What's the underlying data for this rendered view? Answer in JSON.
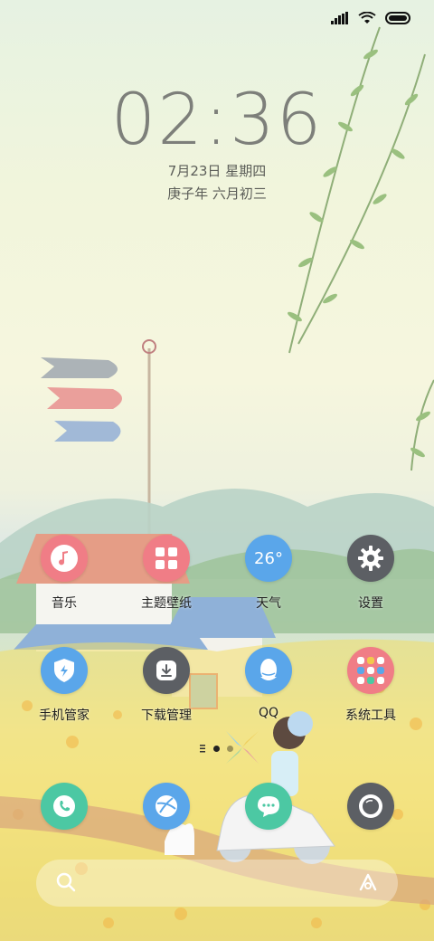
{
  "status": {
    "signal_icon": "cellular-signal-icon",
    "wifi_icon": "wifi-icon",
    "battery_icon": "battery-icon"
  },
  "lockscreen": {
    "time": "02:36",
    "date": "7月23日 星期四",
    "lunar_date": "庚子年 六月初三"
  },
  "apps": [
    {
      "id": "music",
      "label": "音乐",
      "icon": "music-note-icon",
      "color": "#f07d86"
    },
    {
      "id": "themes",
      "label": "主题壁纸",
      "icon": "theme-grid-icon",
      "color": "#f07d86"
    },
    {
      "id": "weather",
      "label": "天气",
      "icon_text": "26°",
      "color": "#5aa6ea"
    },
    {
      "id": "settings",
      "label": "设置",
      "icon": "gear-icon",
      "color": "#5c5f64"
    },
    {
      "id": "security",
      "label": "手机管家",
      "icon": "shield-icon",
      "color": "#5aa6ea"
    },
    {
      "id": "downloads",
      "label": "下载管理",
      "icon": "download-icon",
      "color": "#5c5f64"
    },
    {
      "id": "qq",
      "label": "QQ",
      "icon": "qq-penguin-icon",
      "color": "#5aa6ea"
    },
    {
      "id": "system-tools",
      "label": "系统工具",
      "icon": "folder-icon",
      "color": "#f07d86"
    }
  ],
  "dock": [
    {
      "id": "phone",
      "icon": "phone-icon",
      "color": "#4cc8a3"
    },
    {
      "id": "browser",
      "icon": "browser-icon",
      "color": "#5aa6ea"
    },
    {
      "id": "messages",
      "icon": "message-icon",
      "color": "#4cc8a3"
    },
    {
      "id": "camera",
      "icon": "camera-icon",
      "color": "#5c5f64"
    }
  ],
  "search": {
    "search_icon": "search-icon",
    "assistant_icon": "assistant-icon"
  },
  "page_indicator": {
    "pages": 2,
    "current": 1
  }
}
